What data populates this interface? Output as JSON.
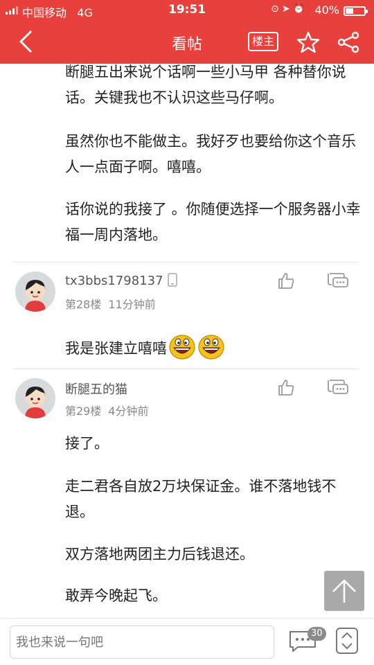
{
  "status_bar": {
    "carrier": "中国移动",
    "network": "4G",
    "time": "19:51",
    "battery": "40%",
    "battery_level": 0.4
  },
  "header": {
    "title": "看帖",
    "op_label": "楼主",
    "icons": [
      "back-icon",
      "star-icon",
      "share-icon"
    ],
    "background": "#e8413d"
  },
  "post_tail": {
    "paragraphs": [
      "断腿五出来说个话啊一些小马甲 各种替你说话。关键我也不认识这些马仔啊。",
      "虽然你也不能做主。我好歹也要给你这个音乐人一点面子啊。嘻嘻。",
      "话你说的我接了 。你随便选择一个服务器小幸福一周内落地。"
    ]
  },
  "replies": [
    {
      "username": "tx3bbs1798137",
      "device_icon": "phone-icon",
      "floor": "第28楼",
      "time": "11分钟前",
      "text": "我是张建立嘻嘻",
      "emojis": [
        "laughing-emoji",
        "laughing-emoji"
      ]
    },
    {
      "username": "断腿五的猫",
      "floor": "第29楼",
      "time": "4分钟前",
      "paragraphs": [
        "接了。",
        "走二君各自放2万块保证金。谁不落地钱不退。",
        "双方落地两团主力后钱退还。",
        "敢弄今晚起飞。"
      ]
    }
  ],
  "bottom_bar": {
    "input_placeholder": "我也来说一句吧",
    "comment_count": "30"
  }
}
